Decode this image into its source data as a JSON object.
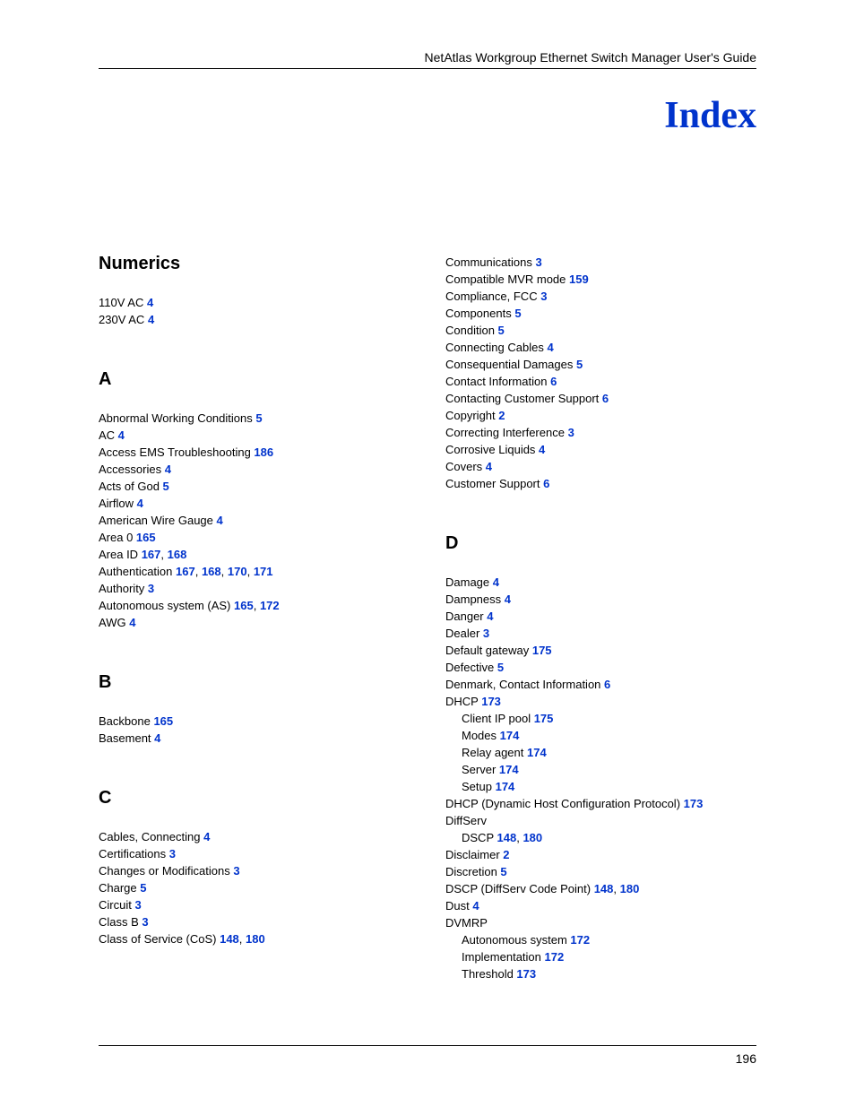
{
  "header": {
    "guide": "NetAtlas Workgroup Ethernet Switch Manager User's Guide"
  },
  "title": "Index",
  "footer": {
    "page": "196"
  },
  "leftCol": [
    {
      "type": "head",
      "text": "Numerics"
    },
    {
      "type": "entry",
      "label": "110V AC",
      "pages": [
        "4"
      ]
    },
    {
      "type": "entry",
      "label": "230V AC",
      "pages": [
        "4"
      ]
    },
    {
      "type": "gap"
    },
    {
      "type": "head",
      "text": "A"
    },
    {
      "type": "entry",
      "label": "Abnormal Working Conditions",
      "pages": [
        "5"
      ]
    },
    {
      "type": "entry",
      "label": "AC",
      "pages": [
        "4"
      ]
    },
    {
      "type": "entry",
      "label": "Access EMS Troubleshooting",
      "pages": [
        "186"
      ]
    },
    {
      "type": "entry",
      "label": "Accessories",
      "pages": [
        "4"
      ]
    },
    {
      "type": "entry",
      "label": "Acts of God",
      "pages": [
        "5"
      ]
    },
    {
      "type": "entry",
      "label": "Airflow",
      "pages": [
        "4"
      ]
    },
    {
      "type": "entry",
      "label": "American Wire Gauge",
      "pages": [
        "4"
      ]
    },
    {
      "type": "entry",
      "label": "Area 0",
      "pages": [
        "165"
      ]
    },
    {
      "type": "entry",
      "label": "Area ID",
      "pages": [
        "167",
        "168"
      ]
    },
    {
      "type": "entry",
      "label": "Authentication",
      "pages": [
        "167",
        "168",
        "170",
        "171"
      ]
    },
    {
      "type": "entry",
      "label": "Authority",
      "pages": [
        "3"
      ]
    },
    {
      "type": "entry",
      "label": "Autonomous system (AS)",
      "pages": [
        "165",
        "172"
      ]
    },
    {
      "type": "entry",
      "label": "AWG",
      "pages": [
        "4"
      ]
    },
    {
      "type": "gap"
    },
    {
      "type": "head",
      "text": "B"
    },
    {
      "type": "entry",
      "label": "Backbone",
      "pages": [
        "165"
      ]
    },
    {
      "type": "entry",
      "label": "Basement",
      "pages": [
        "4"
      ]
    },
    {
      "type": "gap"
    },
    {
      "type": "head",
      "text": "C"
    },
    {
      "type": "entry",
      "label": "Cables, Connecting",
      "pages": [
        "4"
      ]
    },
    {
      "type": "entry",
      "label": "Certifications",
      "pages": [
        "3"
      ]
    },
    {
      "type": "entry",
      "label": "Changes or Modifications",
      "pages": [
        "3"
      ]
    },
    {
      "type": "entry",
      "label": "Charge",
      "pages": [
        "5"
      ]
    },
    {
      "type": "entry",
      "label": "Circuit",
      "pages": [
        "3"
      ]
    },
    {
      "type": "entry",
      "label": "Class B",
      "pages": [
        "3"
      ]
    },
    {
      "type": "entry",
      "label": "Class of Service (CoS)",
      "pages": [
        "148",
        "180"
      ]
    }
  ],
  "rightCol": [
    {
      "type": "entry",
      "label": "Communications",
      "pages": [
        "3"
      ]
    },
    {
      "type": "entry",
      "label": "Compatible MVR mode",
      "pages": [
        "159"
      ]
    },
    {
      "type": "entry",
      "label": "Compliance, FCC",
      "pages": [
        "3"
      ]
    },
    {
      "type": "entry",
      "label": "Components",
      "pages": [
        "5"
      ]
    },
    {
      "type": "entry",
      "label": "Condition",
      "pages": [
        "5"
      ]
    },
    {
      "type": "entry",
      "label": "Connecting Cables",
      "pages": [
        "4"
      ]
    },
    {
      "type": "entry",
      "label": "Consequential Damages",
      "pages": [
        "5"
      ]
    },
    {
      "type": "entry",
      "label": "Contact Information",
      "pages": [
        "6"
      ]
    },
    {
      "type": "entry",
      "label": "Contacting Customer Support",
      "pages": [
        "6"
      ]
    },
    {
      "type": "entry",
      "label": "Copyright",
      "pages": [
        "2"
      ]
    },
    {
      "type": "entry",
      "label": "Correcting Interference",
      "pages": [
        "3"
      ]
    },
    {
      "type": "entry",
      "label": "Corrosive Liquids",
      "pages": [
        "4"
      ]
    },
    {
      "type": "entry",
      "label": "Covers",
      "pages": [
        "4"
      ]
    },
    {
      "type": "entry",
      "label": "Customer Support",
      "pages": [
        "6"
      ]
    },
    {
      "type": "gap"
    },
    {
      "type": "head",
      "text": "D"
    },
    {
      "type": "entry",
      "label": "Damage",
      "pages": [
        "4"
      ]
    },
    {
      "type": "entry",
      "label": "Dampness",
      "pages": [
        "4"
      ]
    },
    {
      "type": "entry",
      "label": "Danger",
      "pages": [
        "4"
      ]
    },
    {
      "type": "entry",
      "label": "Dealer",
      "pages": [
        "3"
      ]
    },
    {
      "type": "entry",
      "label": "Default gateway",
      "pages": [
        "175"
      ]
    },
    {
      "type": "entry",
      "label": "Defective",
      "pages": [
        "5"
      ]
    },
    {
      "type": "entry",
      "label": "Denmark, Contact Information",
      "pages": [
        "6"
      ]
    },
    {
      "type": "entry",
      "label": "DHCP",
      "pages": [
        "173"
      ]
    },
    {
      "type": "sub",
      "label": "Client IP pool",
      "pages": [
        "175"
      ]
    },
    {
      "type": "sub",
      "label": "Modes",
      "pages": [
        "174"
      ]
    },
    {
      "type": "sub",
      "label": "Relay agent",
      "pages": [
        "174"
      ]
    },
    {
      "type": "sub",
      "label": "Server",
      "pages": [
        "174"
      ]
    },
    {
      "type": "sub",
      "label": "Setup",
      "pages": [
        "174"
      ]
    },
    {
      "type": "entry",
      "label": "DHCP (Dynamic Host Configuration Protocol)",
      "pages": [
        "173"
      ]
    },
    {
      "type": "entry",
      "label": "DiffServ",
      "pages": []
    },
    {
      "type": "sub",
      "label": "DSCP",
      "pages": [
        "148",
        "180"
      ]
    },
    {
      "type": "entry",
      "label": "Disclaimer",
      "pages": [
        "2"
      ]
    },
    {
      "type": "entry",
      "label": "Discretion",
      "pages": [
        "5"
      ]
    },
    {
      "type": "entry",
      "label": "DSCP (DiffServ Code Point)",
      "pages": [
        "148",
        "180"
      ]
    },
    {
      "type": "entry",
      "label": "Dust",
      "pages": [
        "4"
      ]
    },
    {
      "type": "entry",
      "label": "DVMRP",
      "pages": []
    },
    {
      "type": "sub",
      "label": "Autonomous system",
      "pages": [
        "172"
      ]
    },
    {
      "type": "sub",
      "label": "Implementation",
      "pages": [
        "172"
      ]
    },
    {
      "type": "sub",
      "label": "Threshold",
      "pages": [
        "173"
      ]
    }
  ]
}
